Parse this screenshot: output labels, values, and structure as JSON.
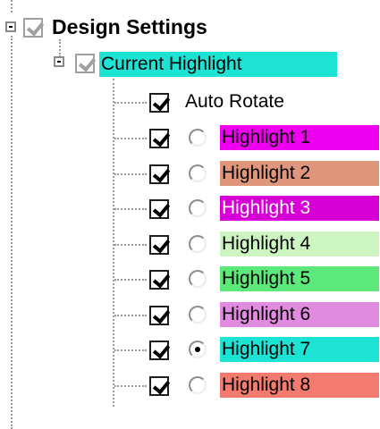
{
  "tree": {
    "root": {
      "label": "Design Settings",
      "checked": true,
      "expanded": true
    },
    "group": {
      "label": "Current Highlight",
      "checked": true,
      "expanded": true,
      "color": "#1de3d4"
    },
    "auto_rotate": {
      "label": "Auto Rotate",
      "checked": true
    },
    "highlights": [
      {
        "label": "Highlight 1",
        "checked": true,
        "selected": false,
        "color": "#f000f0",
        "text_color": "#000000"
      },
      {
        "label": "Highlight 2",
        "checked": true,
        "selected": false,
        "color": "#e0967a",
        "text_color": "#000000"
      },
      {
        "label": "Highlight 3",
        "checked": true,
        "selected": false,
        "color": "#d600d6",
        "text_color": "#ffffff"
      },
      {
        "label": "Highlight 4",
        "checked": true,
        "selected": false,
        "color": "#ccf5c2",
        "text_color": "#000000"
      },
      {
        "label": "Highlight 5",
        "checked": true,
        "selected": false,
        "color": "#5de87a",
        "text_color": "#000000"
      },
      {
        "label": "Highlight 6",
        "checked": true,
        "selected": false,
        "color": "#e08ae0",
        "text_color": "#000000"
      },
      {
        "label": "Highlight 7",
        "checked": true,
        "selected": true,
        "color": "#1de3d4",
        "text_color": "#000000"
      },
      {
        "label": "Highlight 8",
        "checked": true,
        "selected": false,
        "color": "#f27a6e",
        "text_color": "#000000"
      }
    ]
  }
}
